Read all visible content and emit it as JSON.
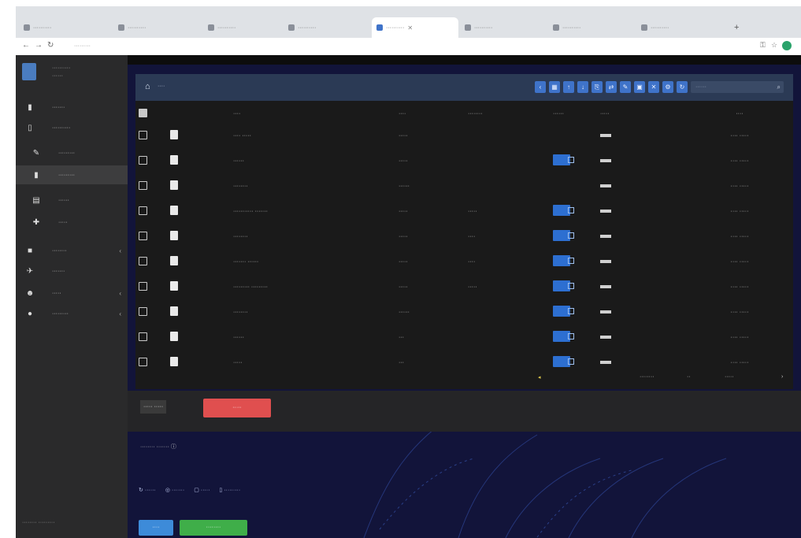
{
  "browser": {
    "tabs": [
      {
        "label": "··········"
      },
      {
        "label": "··········"
      },
      {
        "label": "··········"
      },
      {
        "label": "··········"
      },
      {
        "label": "··········"
      },
      {
        "label": "··········"
      },
      {
        "label": "··········"
      },
      {
        "label": "··········"
      }
    ],
    "url": "·········"
  },
  "sidebar": {
    "brand_line1": "··········",
    "brand_line2": "······",
    "items": [
      {
        "icon": "file-icon",
        "label": "·······"
      },
      {
        "icon": "file-icon",
        "label": "··········"
      },
      {
        "icon": "pencil-icon",
        "label": "·········"
      },
      {
        "icon": "file-icon",
        "label": "·········"
      },
      {
        "icon": "book-icon",
        "label": "······"
      },
      {
        "icon": "puzzle-icon",
        "label": "·····"
      },
      {
        "icon": "gear-icon",
        "label": "········"
      },
      {
        "icon": "rocket-icon",
        "label": "·······"
      },
      {
        "icon": "user-icon",
        "label": "·····"
      },
      {
        "icon": "info-icon",
        "label": "·········"
      }
    ],
    "footer": "········ ·········"
  },
  "panel": {
    "breadcrumb": "····",
    "search_placeholder": "······",
    "columns": [
      "",
      "",
      "····",
      "····",
      "········",
      "······",
      "·····",
      "····"
    ],
    "rows": [
      {
        "name": "···· ·····",
        "size": "·····",
        "modified": "",
        "date": "···· ·····"
      },
      {
        "name": "······",
        "size": "·····",
        "modified": "",
        "date": "···· ·····"
      },
      {
        "name": "········",
        "size": "······",
        "modified": "",
        "date": "···· ·····"
      },
      {
        "name": "··········· ·······",
        "size": "·····",
        "modified": "·····",
        "date": "···· ·····"
      },
      {
        "name": "········",
        "size": "·····",
        "modified": "····",
        "date": "···· ·····"
      },
      {
        "name": "······· ······",
        "size": "·····",
        "modified": "····",
        "date": "···· ·····"
      },
      {
        "name": "········· ·········",
        "size": "·····",
        "modified": "·····",
        "date": "···· ·····"
      },
      {
        "name": "········",
        "size": "······",
        "modified": "",
        "date": "···· ·····"
      },
      {
        "name": "······",
        "size": "···",
        "modified": "",
        "date": "···· ·····"
      },
      {
        "name": "·····",
        "size": "···",
        "modified": "",
        "date": "···· ·····"
      }
    ],
    "pager_label": "········",
    "pager_select": "··",
    "pager_pages": "·····"
  },
  "status": {
    "size_label": "····· ·····",
    "delete_label": "·····",
    "dir_info": "········ ·······"
  },
  "actions": [
    "······",
    "·······",
    "·····",
    "·········"
  ],
  "footer_buttons": [
    {
      "label": "····",
      "color": "#3d8bd9"
    },
    {
      "label": "········",
      "color": "#3fae49"
    }
  ],
  "colors": {
    "accent": "#3f73c9",
    "danger": "#e04f4f",
    "success": "#3fae49"
  }
}
